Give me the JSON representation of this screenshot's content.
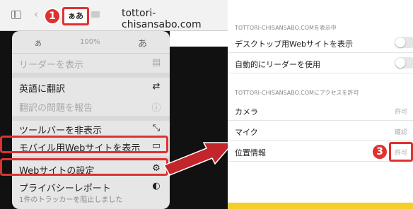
{
  "browser": {
    "url": "tottori-chisansabo.com",
    "page_menu_button_label": "ぁあ",
    "back_icon": "chevron-left-icon",
    "forward_icon": "chevron-right-icon"
  },
  "steps": {
    "one": "1",
    "three": "3"
  },
  "menu": {
    "zoom": {
      "small": "あ",
      "percent": "100%",
      "large": "あ"
    },
    "items": [
      {
        "label": "リーダーを表示",
        "icon": "reader-icon",
        "glyph": "▤",
        "disabled": true
      },
      {
        "label": "英語に翻訳",
        "icon": "translate-icon",
        "glyph": "⇄",
        "disabled": false
      },
      {
        "label": "翻訳の問題を報告",
        "icon": "info-icon",
        "glyph": "ⓘ",
        "disabled": true
      },
      {
        "label": "ツールバーを非表示",
        "icon": "collapse-arrows-icon",
        "glyph": "⤡",
        "disabled": false
      },
      {
        "label": "モバイル用Webサイトを表示",
        "icon": "mobile-site-icon",
        "glyph": "▭",
        "disabled": false
      },
      {
        "label": "Webサイトの設定",
        "icon": "settings-gear-icon",
        "glyph": "⚙",
        "disabled": false
      },
      {
        "label": "プライバシーレポート",
        "sub": "1件のトラッカーを阻止しました",
        "icon": "shield-icon",
        "glyph": "◐",
        "disabled": false
      }
    ]
  },
  "settings": {
    "section1_title": "TOTTORI-CHISANSABO.COMを表示中",
    "rows1": [
      {
        "label": "デスクトップ用Webサイトを表示",
        "on": false
      },
      {
        "label": "自動的にリーダーを使用",
        "on": false
      }
    ],
    "section2_title": "TOTTORI-CHISANSABO.COMにアクセスを許可",
    "rows2": [
      {
        "label": "カメラ",
        "value": "許可"
      },
      {
        "label": "マイク",
        "value": "確認"
      },
      {
        "label": "位置情報",
        "value": "許可"
      }
    ]
  },
  "colors": {
    "highlight": "#e03131",
    "background": "#f4cf2c",
    "panel": "#e6e6e6"
  }
}
